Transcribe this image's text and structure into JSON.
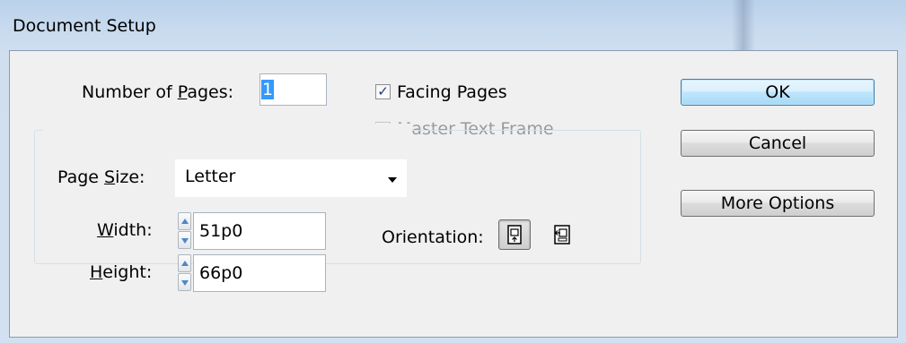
{
  "window": {
    "title": "Document Setup"
  },
  "pages": {
    "label_pre": "Number of ",
    "label_u": "P",
    "label_post": "ages:",
    "value": "1"
  },
  "facing_pages": {
    "label": "Facing Pages",
    "checked": true
  },
  "master_text_frame": {
    "label": "Master Text Frame",
    "checked": false,
    "enabled": false
  },
  "page_size": {
    "label_pre": "Page ",
    "label_u": "S",
    "label_post": "ize:",
    "value": "Letter"
  },
  "width": {
    "label_u": "W",
    "label_post": "idth:",
    "value": "51p0"
  },
  "height": {
    "label_u": "H",
    "label_post": "eight:",
    "value": "66p0"
  },
  "orientation": {
    "label": "Orientation:",
    "selected": "portrait",
    "options": [
      "portrait-icon",
      "landscape-icon"
    ]
  },
  "buttons": {
    "ok": "OK",
    "cancel": "Cancel",
    "more_options": "More Options"
  },
  "colors": {
    "selection": "#3399ff",
    "default_button_border": "#3c7fb1"
  }
}
